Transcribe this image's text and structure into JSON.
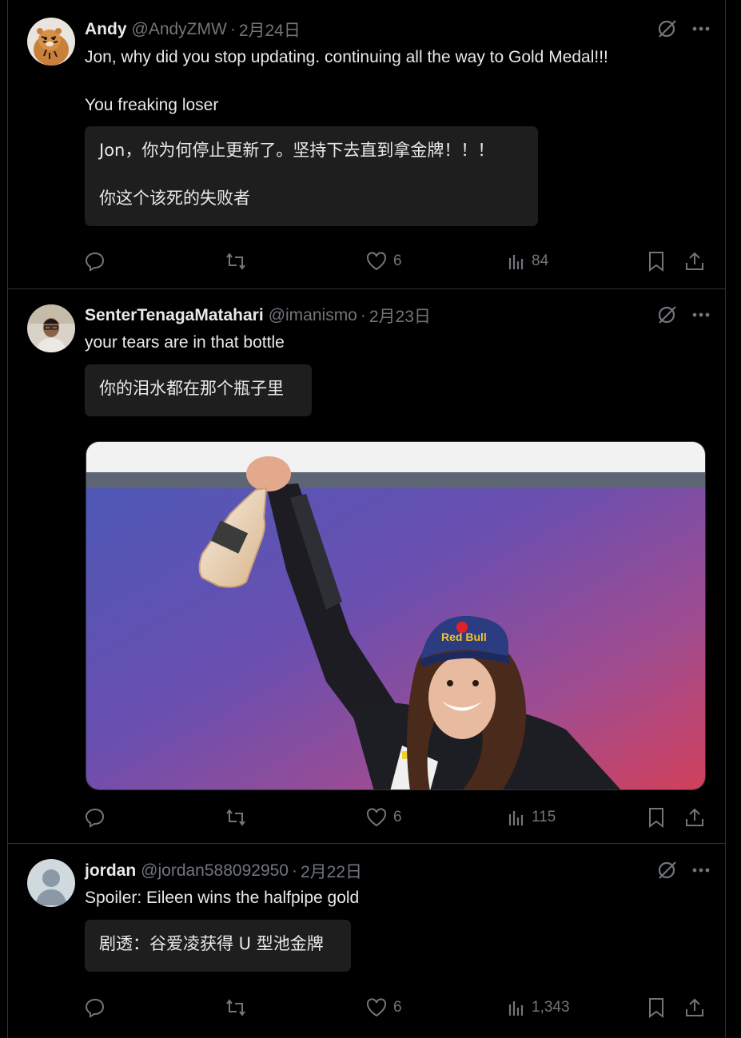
{
  "tweets": [
    {
      "name": "Andy",
      "handle": "@AndyZMW",
      "date": "2月24日",
      "text": "Jon, why did you stop updating. continuing all the way to Gold Medal!!!\n\nYou freaking loser",
      "translation": "Jon，你为何停止更新了。坚持下去直到拿金牌！！！\n\n你这个该死的失败者",
      "likes": "6",
      "views": "84",
      "avatar_icon": "tiger-avatar"
    },
    {
      "name": "SenterTenagaMatahari",
      "handle": "@imanismo",
      "date": "2月23日",
      "text": "your tears are in that bottle",
      "translation": "你的泪水都在那个瓶子里",
      "likes": "6",
      "views": "115",
      "avatar_icon": "person-photo-avatar",
      "image_icon": "athlete-holding-bottle-photo",
      "image_cap_text": "Red Bull"
    },
    {
      "name": "jordan",
      "handle": "@jordan588092950",
      "date": "2月22日",
      "text": "Spoiler: Eileen wins the halfpipe gold",
      "translation": "剧透：谷爱凌获得 U 型池金牌",
      "likes": "6",
      "views": "1,343",
      "avatar_icon": "default-avatar"
    }
  ],
  "separator_dot": "·",
  "colors": {
    "background": "#000000",
    "text": "#e7e9ea",
    "muted": "#71767b",
    "translation_bg": "#1e1e1f",
    "border": "#2f3336"
  }
}
